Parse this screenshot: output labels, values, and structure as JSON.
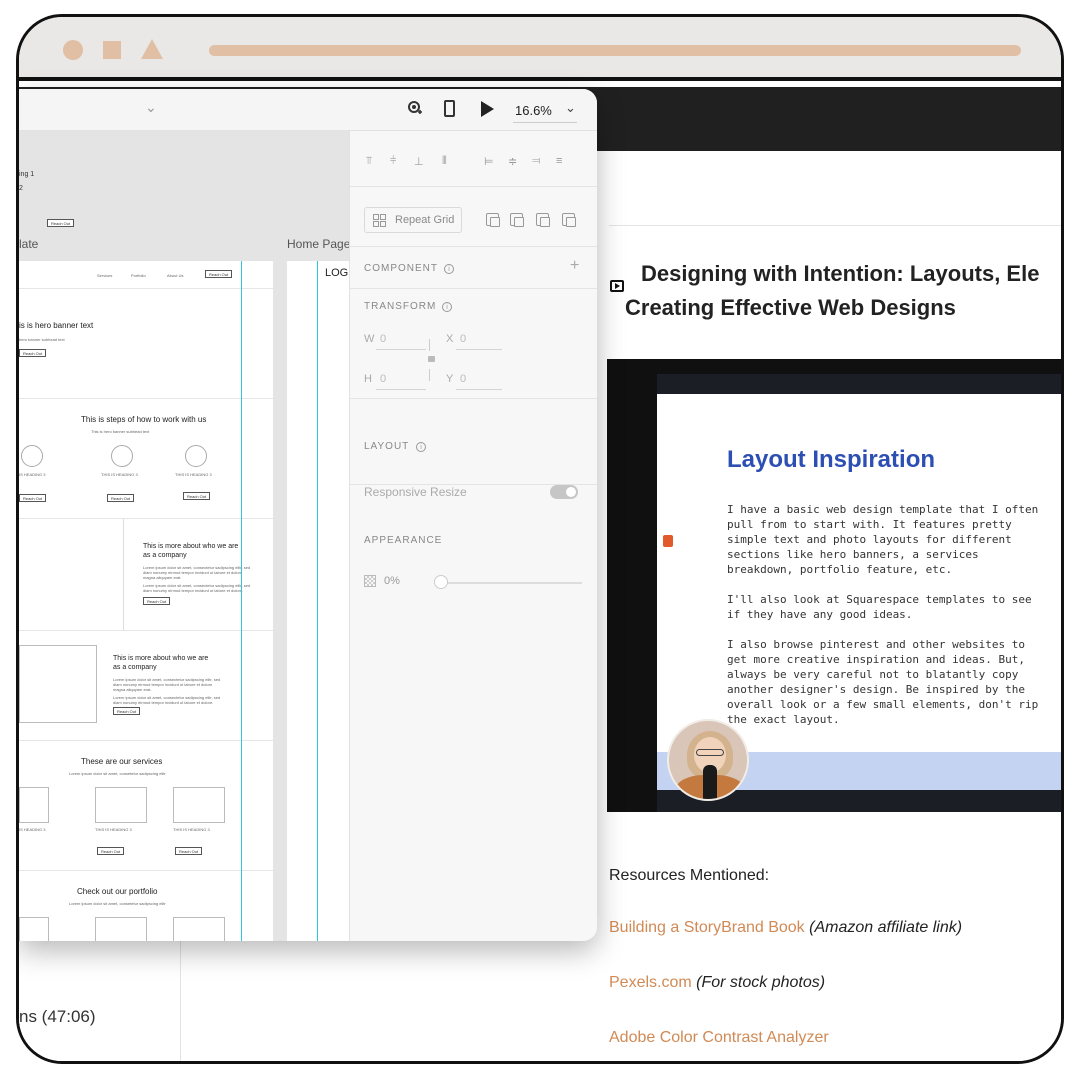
{
  "colors": {
    "accent_peach": "#e0bfa4",
    "link": "#d18a55",
    "slide_title": "#2d4fb3",
    "guide": "#31c6e0"
  },
  "app": {
    "zoom": "16.6%",
    "canvas": {
      "snippets": [
        "ing 1",
        "2",
        "Reach Out"
      ],
      "artboard1_label": "late",
      "artboard2_label": "Home Page",
      "artboard2_logo": "LOG",
      "wireframe": {
        "nav": [
          "Services",
          "Portfolio",
          "About Us",
          "Reach Out"
        ],
        "hero_text": "is is hero banner text",
        "hero_sub": "hero banner subhead text",
        "hero_btn": "Reach Out",
        "steps_title": "This is steps of how to work with us",
        "steps_sub": "This is hero banner subhead text",
        "heading_label": "THIS IS HEADING 3",
        "heading_label_cut": "IS HEADING 3",
        "para_text": "This is a paragraph 1 describing this numbered step or service.",
        "para_text_cut": "paragraph 1 describing this bered step or service.",
        "btn": "Reach Out",
        "about_title_1": "This is more about who we are",
        "about_title_2": "as a company",
        "lorem": "Lorem ipsum dolor sit amet, consectetur sadipscing elitr, sed diam nonumy eirmod tempor invidunt ut labore et dolore magna aliquyam erat.",
        "lorem_2": "Lorem ipsum dolor sit amet, consectetur sadipscing elitr, sed diam nonumy eirmod tempor invidunt ut labore et dolore.",
        "services_title": "These are our services",
        "services_sub": "Lorem ipsum dolor sit amet, consetetur sadipscing elitr",
        "portfolio_title": "Check out our portfolio",
        "portfolio_sub": "Lorem ipsum dolor sit amet, consetetur sadipscing elitr"
      }
    },
    "properties": {
      "repeat_grid": "Repeat Grid",
      "component_label": "COMPONENT",
      "transform_label": "TRANSFORM",
      "w_label": "W",
      "w_value": "0",
      "h_label": "H",
      "h_value": "0",
      "x_label": "X",
      "x_value": "0",
      "y_label": "Y",
      "y_value": "0",
      "layout_label": "LAYOUT",
      "responsive_resize": "Responsive Resize",
      "appearance_label": "APPEARANCE",
      "opacity": "0%"
    }
  },
  "site": {
    "sidebar_duration": "ns (47:06)",
    "article_title_line1": "Designing with Intention: Layouts, Ele",
    "article_title_line2": "Creating Effective Web Designs",
    "slide": {
      "title": "Layout Inspiration",
      "paragraphs": [
        "I have a basic web design template that I often\npull from to start with. It features pretty\nsimple text and photo layouts for different\nsections like hero banners, a services\nbreakdown, portfolio feature, etc.",
        "I'll also look at Squarespace templates to see\nif they have any good ideas.",
        "I also browse pinterest and other websites to\nget more creative inspiration and ideas. But,\nalways be very careful not to blatantly copy\nanother designer's design. Be inspired by the\noverall look or a few small elements, don't rip\nthe exact layout."
      ]
    },
    "resources_heading": "Resources Mentioned:",
    "resources": [
      {
        "link": "Building a StoryBrand Book",
        "note": "(Amazon affiliate link)"
      },
      {
        "link": "Pexels.com",
        "note": "(For stock photos)"
      },
      {
        "link": "Adobe Color Contrast Analyzer",
        "note": ""
      }
    ]
  }
}
